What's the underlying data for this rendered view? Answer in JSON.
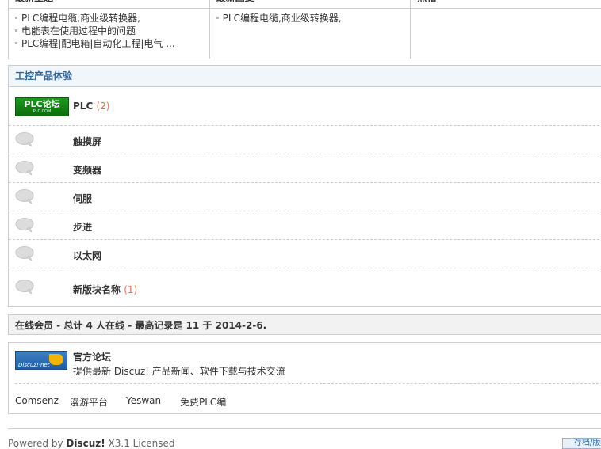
{
  "top_panel": {
    "col1_title": "最新主题",
    "col2_title": "最新回复",
    "col3_title": "热帖",
    "col1_items": [
      "PLC编程电缆,商业级转换器,",
      "电能表在使用过程中的问题",
      "PLC编程|配电箱|自动化工程|电气 ..."
    ],
    "col2_items": [
      "PLC编程电缆,商业级转换器,"
    ]
  },
  "group": {
    "title": "工控产品体验",
    "forums": [
      {
        "name": "PLC",
        "count": "(2)",
        "icon": "plc-logo"
      },
      {
        "name": "触摸屏",
        "count": "",
        "icon": "speech-bubble-icon"
      },
      {
        "name": "变频器",
        "count": "",
        "icon": "speech-bubble-icon"
      },
      {
        "name": "伺服",
        "count": "",
        "icon": "speech-bubble-icon"
      },
      {
        "name": "步进",
        "count": "",
        "icon": "speech-bubble-icon"
      },
      {
        "name": "以太网",
        "count": "",
        "icon": "speech-bubble-icon"
      },
      {
        "name": "新版块名称",
        "count": "(1)",
        "icon": "speech-bubble-icon"
      }
    ],
    "plc_logo_text": "PLC论坛",
    "plc_logo_sub": "PLC.COM"
  },
  "online": {
    "text": "在线会员 - 总计 4 人在线 - 最高记录是 11 于 2014-2-6."
  },
  "links": {
    "official_title": "官方论坛",
    "official_desc": "提供最新 Discuz! 产品新闻、软件下载与技术交流",
    "logo_label": "Discuz!·net",
    "text_links": [
      "Comsenz",
      "漫游平台",
      "Yeswan",
      "免费PLC编"
    ]
  },
  "footer": {
    "powered_prefix": "Powered by ",
    "powered_brand": "Discuz!",
    "powered_suffix": " X3.1 Licensed",
    "archiver": "存档/版"
  },
  "colors": {
    "count": "#f26c4f",
    "group_header_bg": "#f0f6fa",
    "group_header_text": "#336699"
  }
}
